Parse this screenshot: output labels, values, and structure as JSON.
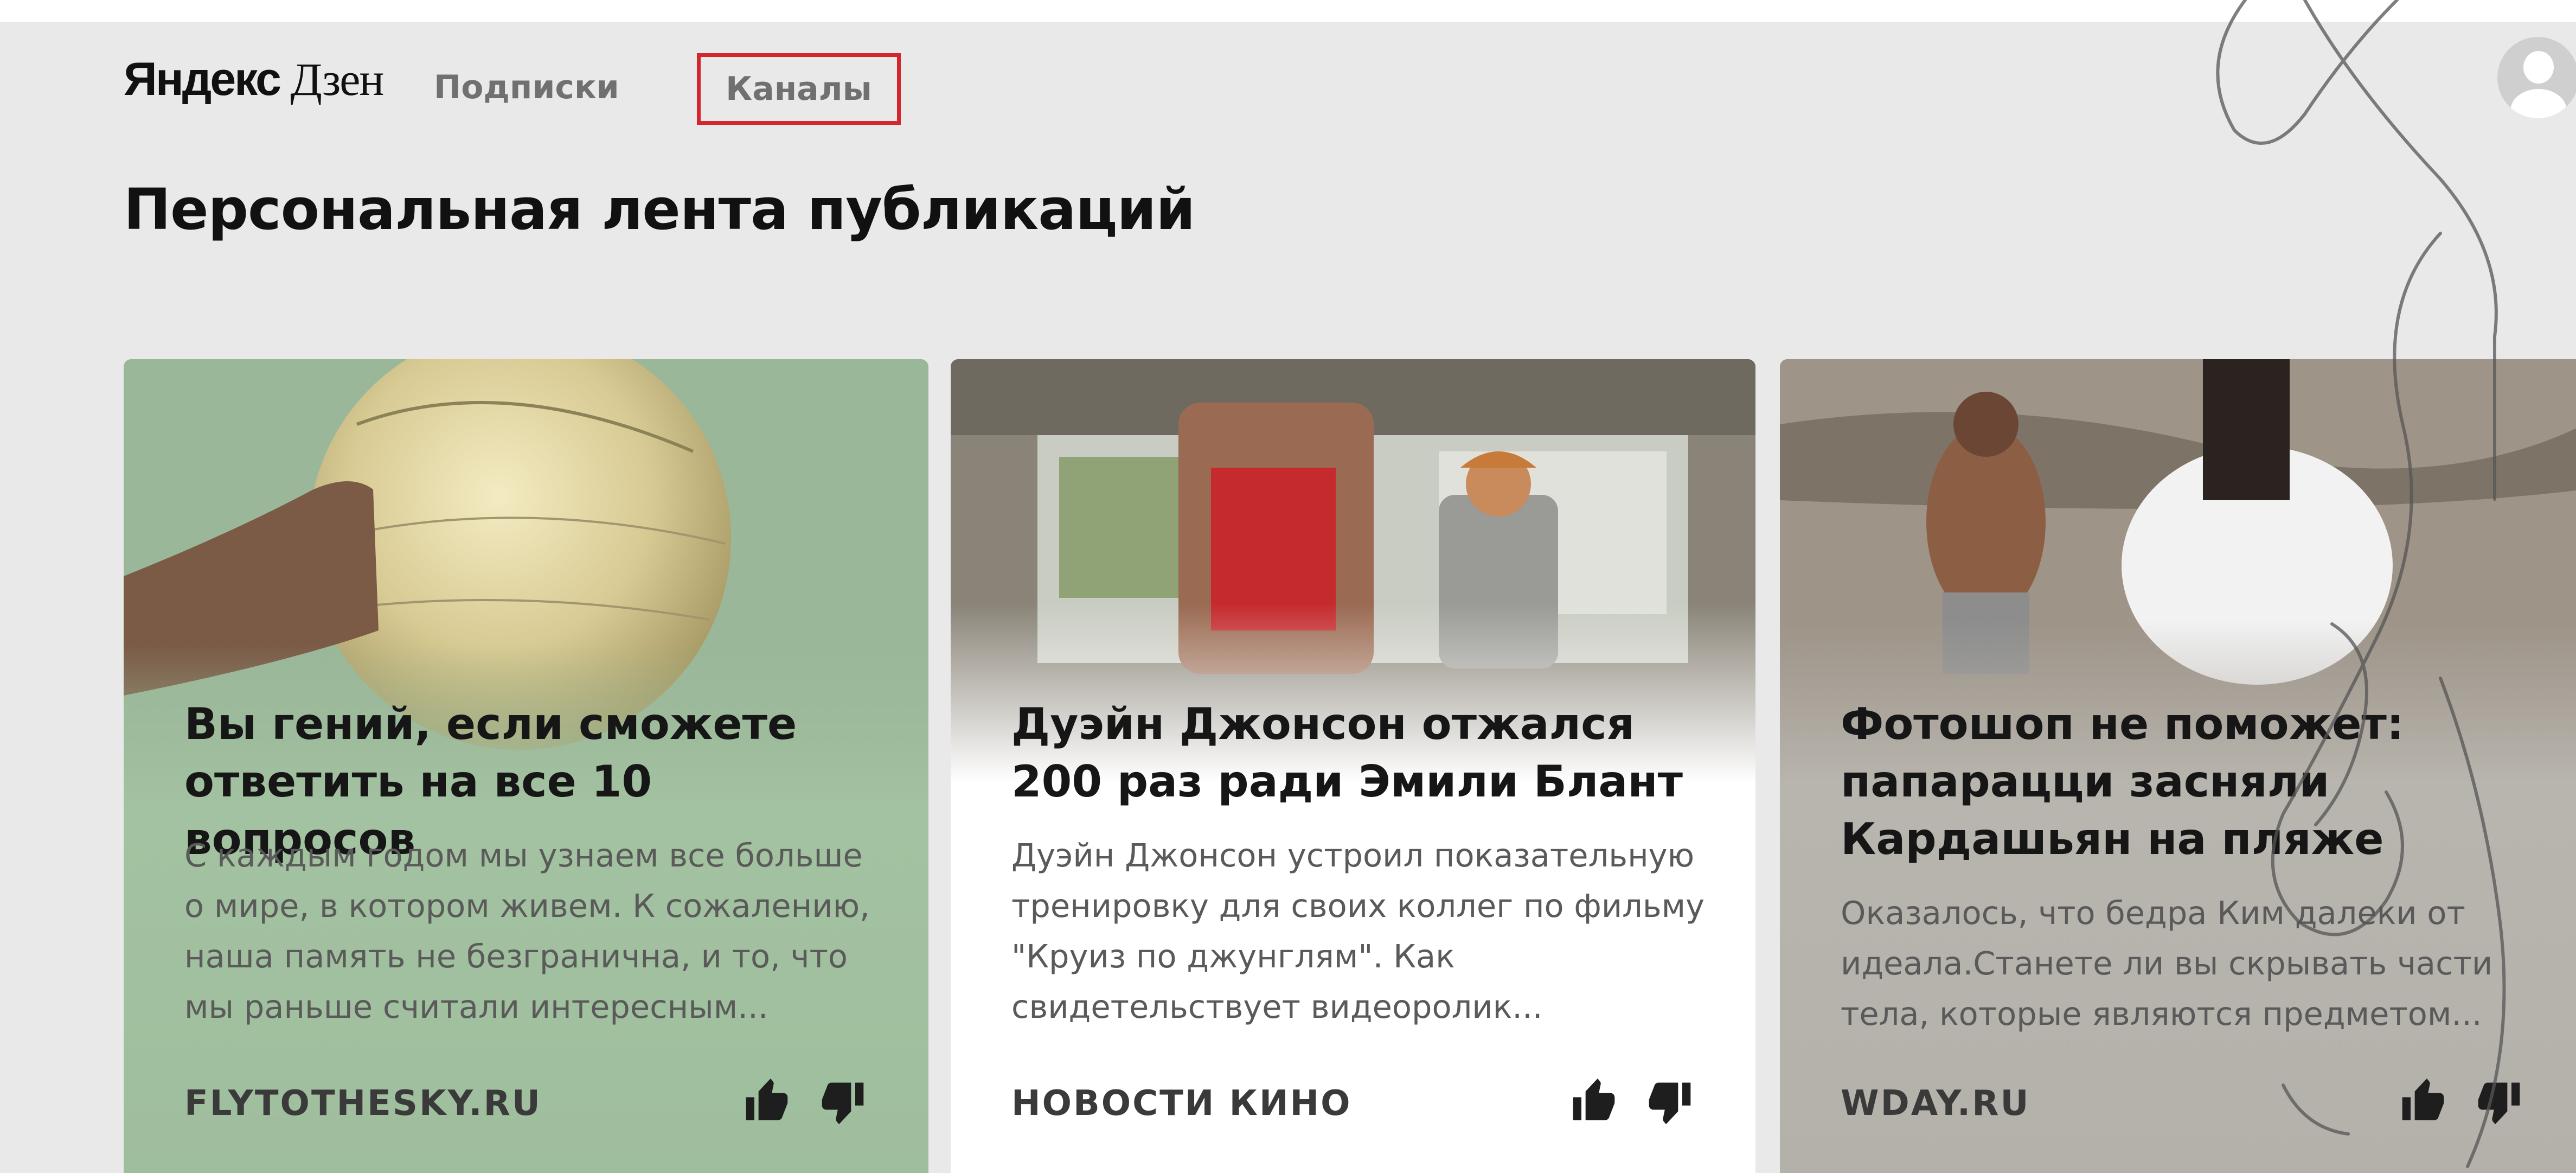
{
  "header": {
    "logo_yandex": "Яндекс",
    "logo_dzen": "Дзен",
    "nav": {
      "subscriptions": "Подписки",
      "channels": "Каналы"
    }
  },
  "page_title": "Персональная лента публикаций",
  "cards": [
    {
      "title": "Вы гений, если сможете ответить на все 10 вопросов",
      "text": "С каждым годом мы узнаем все больше о мире, в котором живем. К сожалению, наша память не безгранична, и то, что мы раньше считали интересным...",
      "source": "FLYTOTHESKY.RU"
    },
    {
      "title": "Дуэйн Джонсон отжался 200 раз ради Эмили Блант",
      "text": "Дуэйн Джонсон устроил показательную тренировку для своих коллег по фильму \"Круиз по джунглям\". Как свидетельствует видеоролик...",
      "source": "НОВОСТИ КИНО"
    },
    {
      "title": "Фотошоп не поможет: папарацци засняли Кардашьян на пляже",
      "text": "Оказалось, что бедра Ким далеки от идеала.Станете ли вы скрывать части тела, которые являются предметом...",
      "source": "WDAY.RU"
    }
  ],
  "icons": {
    "like": "thumbs-up-icon",
    "dislike": "thumbs-down-icon",
    "avatar": "user-avatar-icon",
    "watermark": "signature-watermark"
  },
  "colors": {
    "highlight_border": "#d3262e",
    "page_background": "#e9e9e9",
    "card1_background": "#9fbe9d",
    "card3_background": "#b4b1aa"
  }
}
